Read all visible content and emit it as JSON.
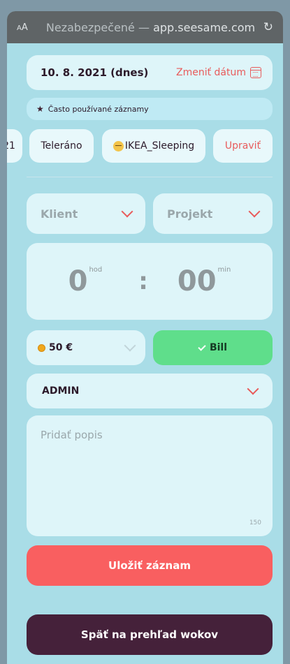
{
  "browser": {
    "aa_large": "A",
    "aa_small": "A",
    "url_prefix": "Nezabezpečené —",
    "url_host": "app.seesame.com",
    "reload_icon": "reload-icon"
  },
  "date": {
    "value": "10. 8. 2021 (dnes)",
    "change_label": "Zmeniť dátum",
    "icon": "calendar-icon"
  },
  "favorites": {
    "label": "Často používané záznamy",
    "icon": "star-icon",
    "chips": [
      {
        "label": "21"
      },
      {
        "label": "Teleráno"
      },
      {
        "label": "IKEA_Sleeping",
        "icon": "sleepy-face-icon"
      }
    ],
    "edit_label": "Upraviť"
  },
  "client": {
    "placeholder": "Klient"
  },
  "project": {
    "placeholder": "Projekt"
  },
  "time": {
    "hours": "0",
    "hours_unit": "hod",
    "separator": ":",
    "minutes": "00",
    "minutes_unit": "min"
  },
  "rate": {
    "value": "50 €",
    "icon": "coin-icon"
  },
  "bill": {
    "label": "Bill",
    "icon": "check-icon"
  },
  "activity": {
    "value": "ADMIN"
  },
  "description": {
    "placeholder": "Pridať popis",
    "remaining": "150"
  },
  "actions": {
    "save_label": "Uložiť záznam",
    "back_label": "Späť na prehľad wokov"
  },
  "colors": {
    "background": "#a9dde7",
    "card": "#def5f9",
    "accent_red": "#f95f60",
    "bill_green": "#5fde8b",
    "dark_button": "#45213a"
  }
}
